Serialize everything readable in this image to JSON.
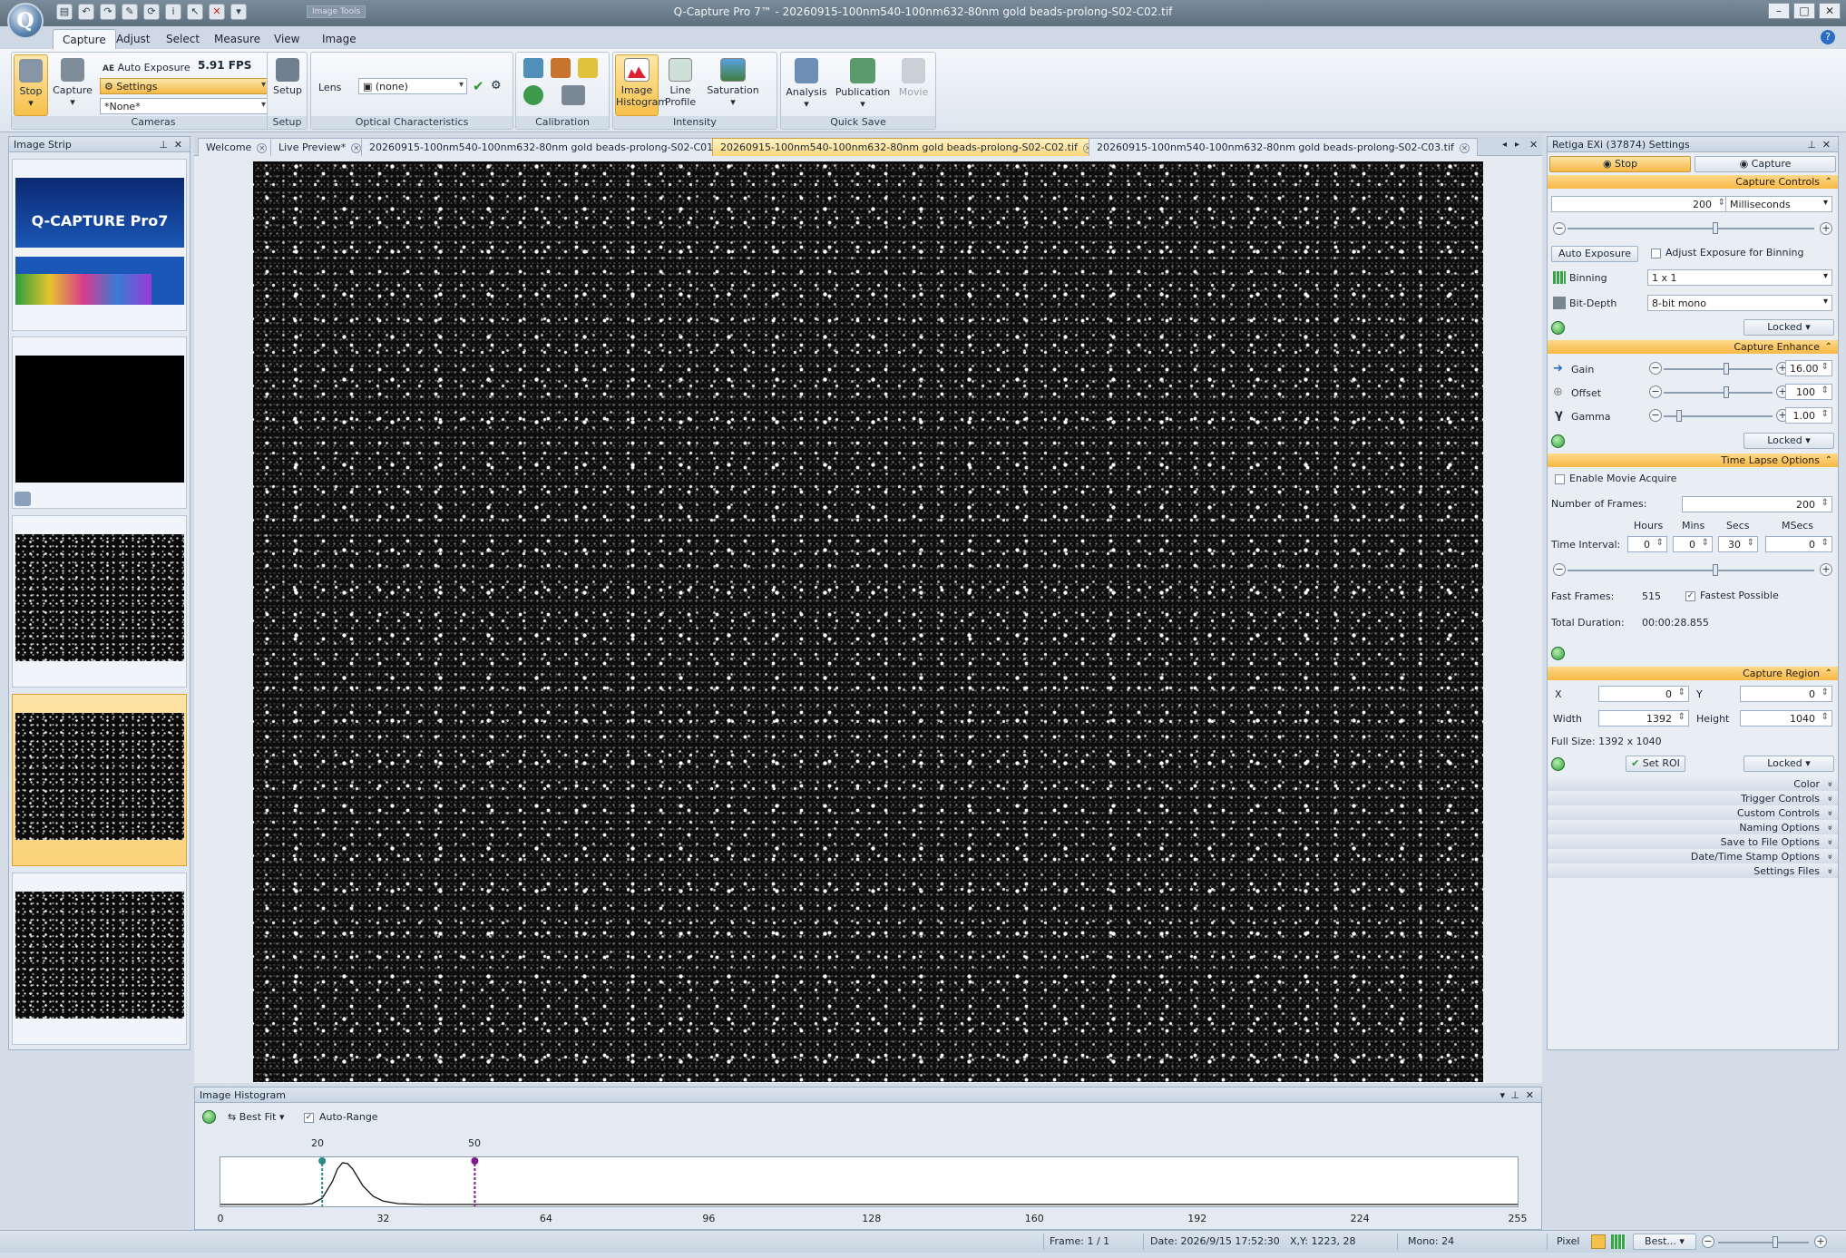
{
  "window": {
    "title": "Q-Capture Pro 7™ - 20260915-100nm540-100nm632-80nm gold beads-prolong-S02-C02.tif",
    "context_tab": "Image Tools"
  },
  "ribbon_tabs": [
    "Capture",
    "Adjust",
    "Select",
    "Measure",
    "View",
    "Image"
  ],
  "cameras": {
    "stop_label": "Stop",
    "capture_label": "Capture",
    "ae_label": "Auto Exposure",
    "fps": "5.91 FPS",
    "settings_label": "Settings",
    "preset": "*None*",
    "group": "Cameras"
  },
  "setup": {
    "label": "Setup",
    "group": "Setup"
  },
  "optical": {
    "lens_label": "Lens",
    "lens_value": "(none)",
    "group": "Optical Characteristics"
  },
  "calibration": {
    "group": "Calibration"
  },
  "intensity": {
    "hist_l1": "Image",
    "hist_l2": "Histogram",
    "line_l1": "Line",
    "line_l2": "Profile",
    "sat_label": "Saturation",
    "group": "Intensity"
  },
  "quicksave": {
    "analysis": "Analysis",
    "publication": "Publication",
    "movie": "Movie",
    "group": "Quick Save"
  },
  "image_strip": {
    "title": "Image Strip",
    "splash_title": "Q-CAPTURE Pro7"
  },
  "doc_tabs": [
    "Welcome",
    "Live Preview*",
    "20260915-100nm540-100nm632-80nm gold beads-prolong-S02-C01.tif",
    "20260915-100nm540-100nm632-80nm  gold  beads-prolong-S02-C02.tif",
    "20260915-100nm540-100nm632-80nm gold beads-prolong-S02-C03.tif"
  ],
  "histogram": {
    "title": "Image Histogram",
    "fit_label": "Best Fit",
    "autorange_label": "Auto-Range",
    "autorange": true,
    "min_marker": "20",
    "max_marker": "50",
    "x_ticks": [
      "0",
      "32",
      "64",
      "96",
      "128",
      "160",
      "192",
      "224",
      "255"
    ]
  },
  "chart_data": {
    "type": "area",
    "x_range": [
      0,
      255
    ],
    "marker_low": 20,
    "marker_high": 50,
    "x": [
      0,
      16,
      18,
      20,
      22,
      23,
      24,
      25,
      26,
      27,
      28,
      30,
      32,
      35,
      40,
      64,
      128,
      255
    ],
    "values": [
      0,
      0,
      2,
      15,
      55,
      85,
      100,
      98,
      85,
      65,
      45,
      20,
      8,
      2,
      0,
      0,
      0,
      0
    ]
  },
  "settings": {
    "title": "Retiga EXi (37874) Settings",
    "stop_label": "Stop",
    "capture_label": "Capture",
    "capture_controls": {
      "header": "Capture Controls",
      "exposure": "200",
      "unit": "Milliseconds",
      "ae_button": "Auto Exposure",
      "adjust_binning_label": "Adjust Exposure for Binning",
      "binning_label": "Binning",
      "binning_value": "1 x 1",
      "bitdepth_label": "Bit-Depth",
      "bitdepth_value": "8-bit mono",
      "locked": "Locked"
    },
    "capture_enhance": {
      "header": "Capture Enhance",
      "gain_label": "Gain",
      "gain_value": "16.00",
      "offset_label": "Offset",
      "offset_value": "100",
      "gamma_label": "Gamma",
      "gamma_value": "1.00",
      "locked": "Locked"
    },
    "time_lapse": {
      "header": "Time Lapse Options",
      "enable_label": "Enable Movie Acquire",
      "frames_label": "Number of Frames:",
      "frames_value": "200",
      "hours_label": "Hours",
      "mins_label": "Mins",
      "secs_label": "Secs",
      "msecs_label": "MSecs",
      "interval_label": "Time Interval:",
      "hours": "0",
      "mins": "0",
      "secs": "30",
      "msecs": "0",
      "fast_frames_label": "Fast Frames:",
      "fast_frames_value": "515",
      "fastest_label": "Fastest Possible",
      "duration_label": "Total Duration:",
      "duration_value": "00:00:28.855"
    },
    "capture_region": {
      "header": "Capture Region",
      "x_label": "X",
      "x_value": "0",
      "y_label": "Y",
      "y_value": "0",
      "width_label": "Width",
      "width_value": "1392",
      "height_label": "Height",
      "height_value": "1040",
      "fullsize": "Full Size: 1392 x 1040",
      "setroi_label": "Set ROI",
      "locked": "Locked"
    },
    "collapsed": [
      "Color",
      "Trigger Controls",
      "Custom Controls",
      "Naming Options",
      "Save to File Options",
      "Date/Time Stamp Options",
      "Settings Files"
    ]
  },
  "status": {
    "frame": "Frame: 1 / 1",
    "date": "Date: 2026/9/15 17:52:30",
    "xy": "X,Y: 1223,    28",
    "mono": "Mono:   24",
    "pixel": "Pixel",
    "zoom": "Best..."
  },
  "colors": {
    "accent": "#f7b846",
    "selected": "#fbd27a"
  }
}
